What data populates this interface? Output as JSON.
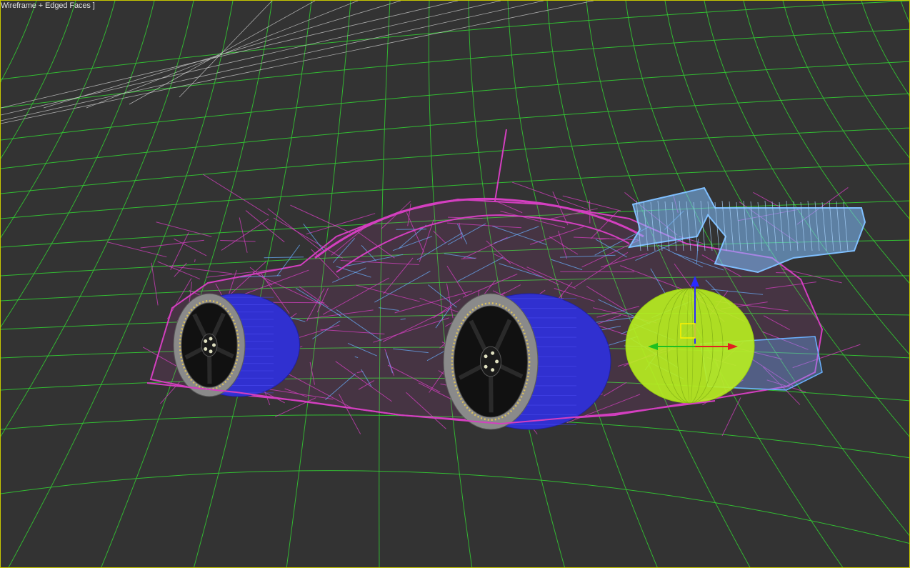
{
  "viewport": {
    "label": "Wireframe + Edged Faces ]",
    "active_border_color": "#c8c800",
    "background_color": "#333333"
  },
  "scene": {
    "grid_color": "#33cc33",
    "body_wire_color": "#d43fc0",
    "cage_wire_color": "#6ab0ff",
    "wing_color": "#7fbfff",
    "tire_color": "#3030d0",
    "rim_color": "#111111",
    "bolt_ring_color": "#d9c060",
    "fuel_tank_color": "#b8f020",
    "gizmo_z_color": "#2a2aff",
    "gizmo_x_color": "#e02020",
    "gizmo_y_color": "#20c020"
  }
}
